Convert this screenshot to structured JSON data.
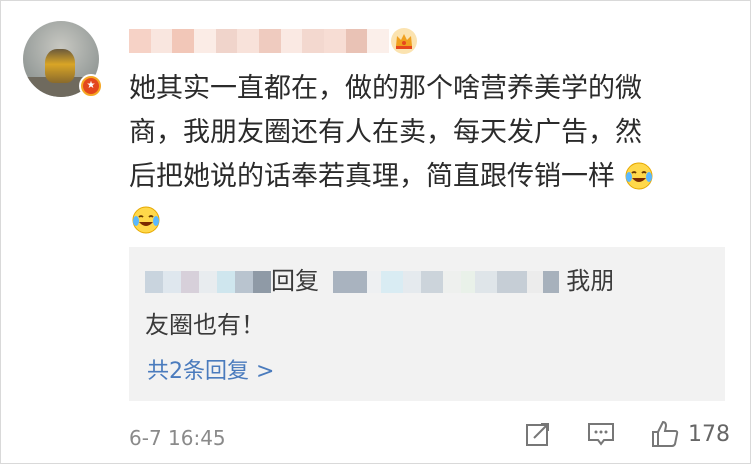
{
  "comment": {
    "line1": "她其实一直都在，做的那个啥营养美学的微",
    "line2": "商，我朋友圈还有人在卖，每天发广告，然",
    "line3": "后把她说的话奉若真理，简直跟传销一样",
    "emoji_icon": "crying-laughing-emoji-icon"
  },
  "reply": {
    "verb": "回复",
    "text_tail": "我朋",
    "text_line2": "友圈也有！",
    "more_label": "共2条回复 >"
  },
  "footer": {
    "time": "6-7 16:45",
    "like_count": "178"
  },
  "colors": {
    "link": "#4a7bbd",
    "badge_orange": "#f5a623",
    "badge_red": "#e3471d"
  }
}
